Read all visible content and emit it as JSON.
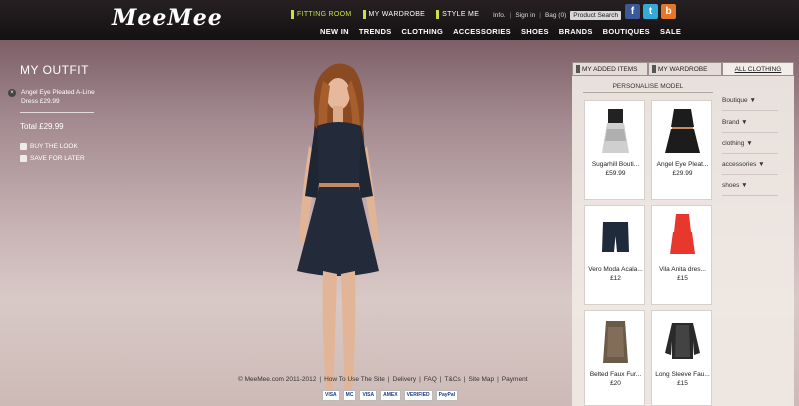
{
  "header": {
    "logo": "MeeMee",
    "topnav": [
      {
        "label": "FITTING ROOM",
        "active": true
      },
      {
        "label": "MY WARDROBE",
        "active": false
      },
      {
        "label": "STYLE ME",
        "active": false
      }
    ],
    "util": {
      "info": "Info.",
      "signin": "Sign in",
      "bag": "Bag (0)",
      "search": "Product Search"
    },
    "social": [
      "f",
      "t",
      "b"
    ],
    "mainnav": [
      "NEW IN",
      "TRENDS",
      "CLOTHING",
      "ACCESSORIES",
      "SHOES",
      "BRANDS",
      "BOUTIQUES",
      "SALE"
    ]
  },
  "outfit": {
    "title": "MY OUTFIT",
    "item": "Angel Eye Pleated A-Line Dress £29.99",
    "total": "Total £29.99",
    "buy": "BUY THE LOOK",
    "save": "SAVE FOR LATER"
  },
  "panel": {
    "tabs": [
      "MY ADDED ITEMS",
      "MY WARDROBE",
      "ALL CLOTHING"
    ],
    "personalise": "PERSONALISE MODEL",
    "products": [
      {
        "name": "Sugarhill Bouti...",
        "price": "£59.99"
      },
      {
        "name": "Angel Eye Pleat...",
        "price": "£29.99"
      },
      {
        "name": "Vero Moda Acala...",
        "price": "£12"
      },
      {
        "name": "Vila Anita dres...",
        "price": "£15"
      },
      {
        "name": "Belted Faux Fur...",
        "price": "£20"
      },
      {
        "name": "Long Sleeve Fau...",
        "price": "£15"
      }
    ],
    "filters": [
      "Boutique ▼",
      "Brand ▼",
      "clothing ▼",
      "accessories ▼",
      "shoes ▼"
    ]
  },
  "footer": {
    "links": [
      "© MeeMee.com 2011-2012",
      "How To Use The Site",
      "Delivery",
      "FAQ",
      "T&Cs",
      "Site Map",
      "Payment"
    ],
    "payments": [
      "VISA",
      "MC",
      "VISA",
      "AMEX",
      "VERIFIED",
      "PayPal"
    ]
  },
  "colors": {
    "accent": "#c8e04a",
    "header": "#1a1618"
  }
}
